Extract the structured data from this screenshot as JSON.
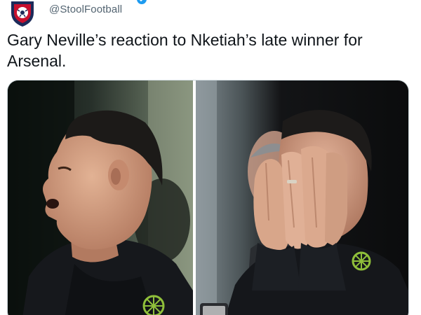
{
  "account": {
    "handle": "@StoolFootball",
    "avatar_icon": "football-crest-icon",
    "verified_icon": "verified-badge-icon"
  },
  "tweet": {
    "text": "Gary Neville’s reaction to Nketiah’s late winner for Arsenal."
  },
  "media": {
    "images": [
      {
        "name": "neville-shocked-photo"
      },
      {
        "name": "neville-hands-on-face-photo"
      }
    ]
  },
  "colors": {
    "text_primary": "#0f1419",
    "text_secondary": "#536471",
    "verified_blue": "#1d9bf0",
    "crest_navy": "#1c2b5a",
    "crest_red": "#c8102e"
  }
}
